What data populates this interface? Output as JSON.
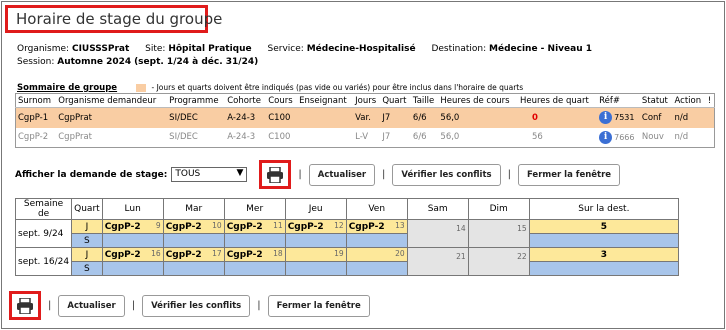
{
  "title": "Horaire de stage du groupe",
  "info": {
    "organisme_label": "Organisme:",
    "organisme_value": "CIUSSSPrat",
    "site_label": "Site:",
    "site_value": "Hôpital Pratique",
    "service_label": "Service:",
    "service_value": "Médecine-Hospitalisé",
    "destination_label": "Destination:",
    "destination_value": "Médecine - Niveau 1",
    "session_label": "Session:",
    "session_value": "Automne 2024",
    "session_range": "(sept. 1/24 à déc. 31/24)"
  },
  "sommaire": {
    "heading": "Sommaire de groupe",
    "legend": "- Jours et quarts doivent être indiqués (pas vide ou variés) pour être inclus dans l'horaire de quarts",
    "legend_color": "#f9cda3",
    "columns": [
      "Surnom",
      "Organisme demandeur",
      "Programme",
      "Cohorte",
      "Cours",
      "Enseignant",
      "Jours",
      "Quart",
      "Taille",
      "Heures de cours",
      "Heures de quart",
      "Réf#",
      "Statut",
      "Action",
      "!"
    ],
    "rows": [
      {
        "surnom": "CgpP-1",
        "organisme": "CgpPrat",
        "programme": "SI/DEC",
        "cohorte": "A-24-3",
        "cours": "C100",
        "enseignant": "",
        "jours": "Var.",
        "quart": "J7",
        "taille": "6/6",
        "heures_cours": "56,0",
        "heures_quart": "0",
        "ref": "7531",
        "statut": "Conf",
        "action": "n/d"
      },
      {
        "surnom": "CgpP-2",
        "organisme": "CgpPrat",
        "programme": "SI/DEC",
        "cohorte": "A-24-3",
        "cours": "C100",
        "enseignant": "",
        "jours": "L-V",
        "quart": "J7",
        "taille": "6/6",
        "heures_cours": "56,0",
        "heures_quart": "56",
        "ref": "7666",
        "statut": "Nouv",
        "action": "n/d"
      }
    ]
  },
  "toolbar": {
    "afficher_label": "Afficher la demande de stage:",
    "select_value": "TOUS",
    "actualiser": "Actualiser",
    "verifier": "Vérifier les conflits",
    "fermer": "Fermer la fenêtre"
  },
  "schedule": {
    "headers": [
      "Semaine de",
      "Quart",
      "Lun",
      "Mar",
      "Mer",
      "Jeu",
      "Ven",
      "Sam",
      "Dim",
      "Sur la dest."
    ],
    "weeks": [
      {
        "label": "sept. 9/24",
        "j": "J",
        "s": "S",
        "days": [
          {
            "t": "CgpP-2",
            "n": "9"
          },
          {
            "t": "CgpP-2",
            "n": "10"
          },
          {
            "t": "CgpP-2",
            "n": "11"
          },
          {
            "t": "CgpP-2",
            "n": "12"
          },
          {
            "t": "CgpP-2",
            "n": "13"
          },
          {
            "t": "",
            "n": "14"
          },
          {
            "t": "",
            "n": "15"
          }
        ],
        "dest": "5"
      },
      {
        "label": "sept. 16/24",
        "j": "J",
        "s": "S",
        "days": [
          {
            "t": "CgpP-2",
            "n": "16"
          },
          {
            "t": "CgpP-2",
            "n": "17"
          },
          {
            "t": "CgpP-2",
            "n": "18"
          },
          {
            "t": "",
            "n": "19"
          },
          {
            "t": "",
            "n": "20"
          },
          {
            "t": "",
            "n": "21"
          },
          {
            "t": "",
            "n": "22"
          }
        ],
        "dest": "3"
      }
    ]
  }
}
